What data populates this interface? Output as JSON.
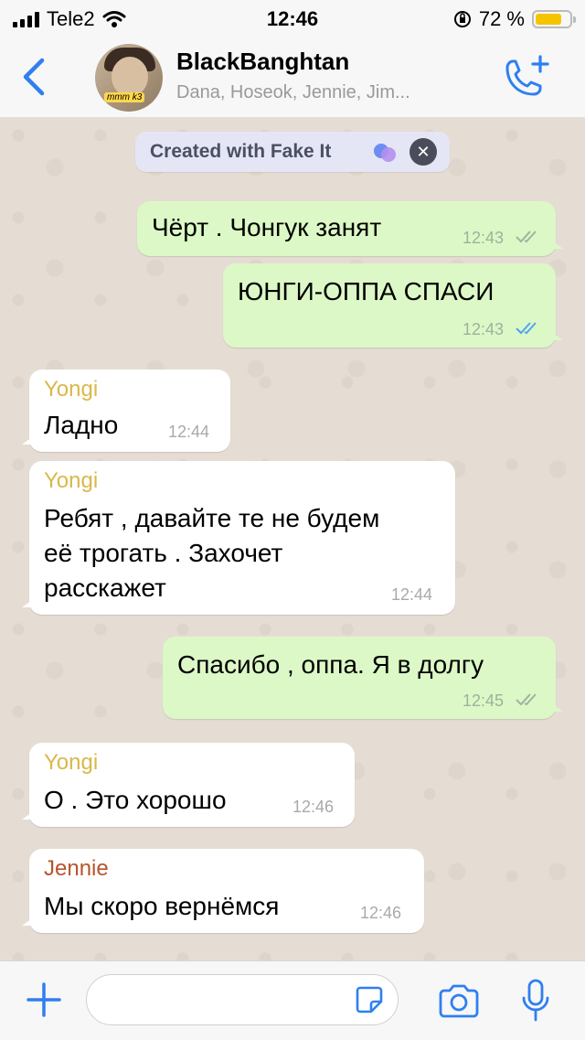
{
  "status_bar": {
    "carrier": "Tele2",
    "time": "12:46",
    "battery": "72 %",
    "battery_level": 0.72
  },
  "header": {
    "title": "BlackBanghtan",
    "subtitle": "Dana, Hoseok, Jennie, Jim...",
    "avatar_icon": "group-avatar",
    "avatar_tag": "mmm k3",
    "back_icon": "chevron-left-icon",
    "call_icon": "add-call-icon"
  },
  "banner": {
    "label": "Created with Fake It",
    "close": "✕"
  },
  "messages": [
    {
      "dir": "out",
      "text": "Чёрт . Чонгук занят",
      "time": "12:43",
      "read": false
    },
    {
      "dir": "out",
      "text": "ЮНГИ-ОППА СПАСИ",
      "time": "12:43",
      "read": true
    },
    {
      "dir": "in",
      "sender": "Yongi",
      "sender_color": "#d9b84a",
      "text": "Ладно",
      "time": "12:44"
    },
    {
      "dir": "in",
      "sender": "Yongi",
      "sender_color": "#d9b84a",
      "text": "Ребят , давайте те не будем\nеё трогать . Захочет\nрасскажет",
      "time": "12:44"
    },
    {
      "dir": "out",
      "text": "Спасибо , оппа. Я в долгу",
      "time": "12:45",
      "read": false
    },
    {
      "dir": "in",
      "sender": "Yongi",
      "sender_color": "#d9b84a",
      "text": "О . Это хорошо",
      "time": "12:46"
    },
    {
      "dir": "in",
      "sender": "Jennie",
      "sender_color": "#b5552c",
      "text": "Мы скоро вернёмся",
      "time": "12:46"
    }
  ],
  "input": {
    "placeholder": "",
    "value": ""
  },
  "colors": {
    "accent": "#2f7ff0",
    "bubble_out": "#dcf8c6",
    "bubble_in": "#ffffff",
    "read_tick": "#4fa4f4",
    "unread_tick": "#a3b3a0"
  }
}
